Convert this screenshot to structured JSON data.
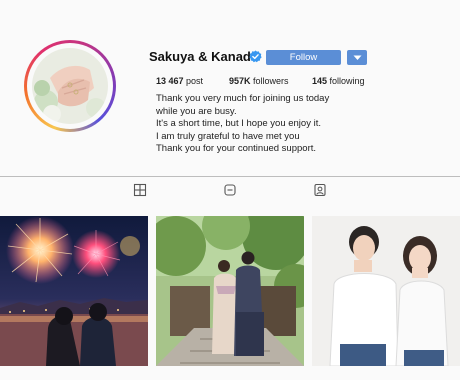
{
  "profile": {
    "username": "Sakuya & Kanade",
    "follow_label": "Follow",
    "stats": {
      "posts_count": "13 467",
      "posts_label": "post",
      "followers_count": "957K",
      "followers_label": "followers",
      "following_count": "145",
      "following_label": "following"
    },
    "bio_lines": [
      "Thank you very much for joining us today",
      "while you are busy.",
      "It's a short time, but I hope you enjoy it.",
      "I am truly grateful to have met you",
      "Thank you for your continued support."
    ]
  },
  "tabs": [
    {
      "icon": "grid-icon"
    },
    {
      "icon": "reels-icon"
    },
    {
      "icon": "tagged-icon"
    }
  ],
  "posts": [
    {
      "subject": "fireworks-photo"
    },
    {
      "subject": "kimono-couple-photo"
    },
    {
      "subject": "white-shirt-couple-photo"
    }
  ],
  "colors": {
    "accent": "#5b8ed6",
    "verified": "#3897f0",
    "background": "#fafafa",
    "divider": "#bdbdbd"
  }
}
